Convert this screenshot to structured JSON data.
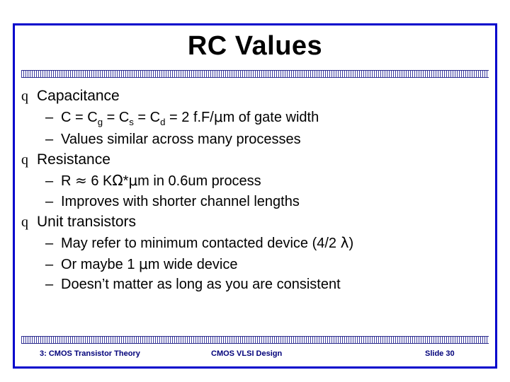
{
  "slide": {
    "title": "RC Values",
    "bullets": [
      {
        "level": 1,
        "marker": "q",
        "segments": [
          {
            "t": "Capacitance"
          }
        ]
      },
      {
        "level": 2,
        "marker": "–",
        "segments": [
          {
            "t": "C = C"
          },
          {
            "t": "g",
            "sub": true
          },
          {
            "t": " = C"
          },
          {
            "t": "s",
            "sub": true
          },
          {
            "t": " = C"
          },
          {
            "t": "d",
            "sub": true
          },
          {
            "t": " = 2 f.F/"
          },
          {
            "t": "μ",
            "sym": true
          },
          {
            "t": "m of gate width"
          }
        ]
      },
      {
        "level": 2,
        "marker": "–",
        "segments": [
          {
            "t": "Values similar across many processes"
          }
        ]
      },
      {
        "level": 1,
        "marker": "q",
        "segments": [
          {
            "t": "Resistance"
          }
        ]
      },
      {
        "level": 2,
        "marker": "–",
        "segments": [
          {
            "t": "R "
          },
          {
            "t": "≈",
            "sym": true
          },
          {
            "t": " 6 K"
          },
          {
            "t": "Ω",
            "sym": true
          },
          {
            "t": "*"
          },
          {
            "t": "μ",
            "sym": true
          },
          {
            "t": "m in 0.6um process"
          }
        ]
      },
      {
        "level": 2,
        "marker": "–",
        "segments": [
          {
            "t": "Improves with shorter channel lengths"
          }
        ]
      },
      {
        "level": 1,
        "marker": "q",
        "segments": [
          {
            "t": "Unit transistors"
          }
        ]
      },
      {
        "level": 2,
        "marker": "–",
        "segments": [
          {
            "t": "May refer to minimum contacted device (4/2 "
          },
          {
            "t": "λ",
            "sym": true
          },
          {
            "t": ")"
          }
        ]
      },
      {
        "level": 2,
        "marker": "–",
        "segments": [
          {
            "t": "Or maybe 1 "
          },
          {
            "t": "μ",
            "sym": true
          },
          {
            "t": "m wide device"
          }
        ]
      },
      {
        "level": 2,
        "marker": "–",
        "segments": [
          {
            "t": "Doesn’t matter as long as you are consistent"
          }
        ]
      }
    ],
    "footer": {
      "left": "3: CMOS Transistor Theory",
      "center": "CMOS VLSI Design",
      "right": "Slide 30"
    },
    "colors": {
      "frame": "#0000cc",
      "footer_text": "#00007a",
      "hatch": "#3b3b9e"
    }
  }
}
